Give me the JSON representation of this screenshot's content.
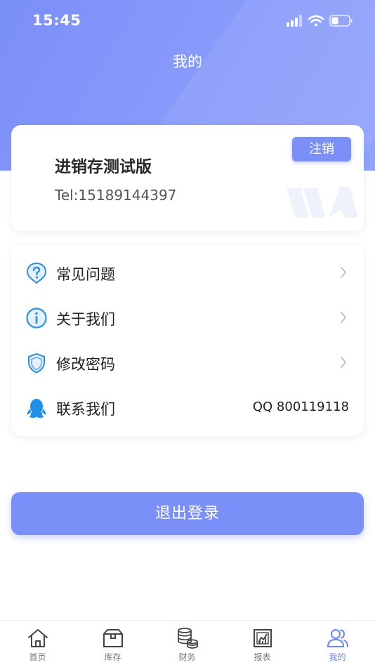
{
  "status_bar": {
    "time": "15:45"
  },
  "header": {
    "title": "我的"
  },
  "profile": {
    "name": "进销存测试版",
    "tel": "Tel:15189144397",
    "logout_label": "注销"
  },
  "menu": {
    "items": [
      {
        "label": "常见问题",
        "icon": "question-icon"
      },
      {
        "label": "关于我们",
        "icon": "info-icon"
      },
      {
        "label": "修改密码",
        "icon": "shield-icon"
      },
      {
        "label": "联系我们",
        "icon": "qq-penguin-icon",
        "value": "QQ 800119118"
      }
    ]
  },
  "exit_label": "退出登录",
  "tabs": [
    {
      "label": "首页",
      "icon": "home-icon"
    },
    {
      "label": "库存",
      "icon": "box-icon"
    },
    {
      "label": "财务",
      "icon": "coins-icon"
    },
    {
      "label": "报表",
      "icon": "report-icon"
    },
    {
      "label": "我的",
      "icon": "user-icon",
      "active": true
    }
  ],
  "colors": {
    "accent": "#7b8ff9",
    "active_tab": "#6c83f6",
    "icon_blue": "#2f8fe0"
  }
}
